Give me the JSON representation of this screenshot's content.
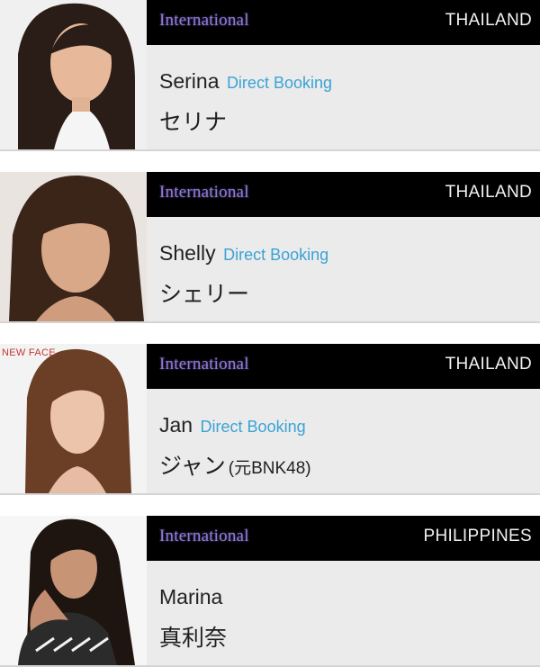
{
  "models": [
    {
      "category": "International",
      "country": "THAILAND",
      "name": "Serina",
      "booking_label": "Direct Booking",
      "kana": "セリナ",
      "kana_suffix": "",
      "badge": ""
    },
    {
      "category": "International",
      "country": "THAILAND",
      "name": "Shelly",
      "booking_label": "Direct Booking",
      "kana": "シェリー",
      "kana_suffix": "",
      "badge": ""
    },
    {
      "category": "International",
      "country": "THAILAND",
      "name": "Jan",
      "booking_label": "Direct Booking",
      "kana": "ジャン",
      "kana_suffix": "(元BNK48)",
      "badge": "NEW FACE"
    },
    {
      "category": "International",
      "country": "PHILIPPINES",
      "name": "Marina",
      "booking_label": "",
      "kana": "真利奈",
      "kana_suffix": "",
      "badge": ""
    }
  ],
  "colors": {
    "header_bg": "#000000",
    "category_text": "#8e7bd6",
    "country_text": "#f2f2f2",
    "panel_bg": "#ebebeb",
    "booking_link": "#3aa3d6",
    "badge_text": "#c0392b"
  }
}
